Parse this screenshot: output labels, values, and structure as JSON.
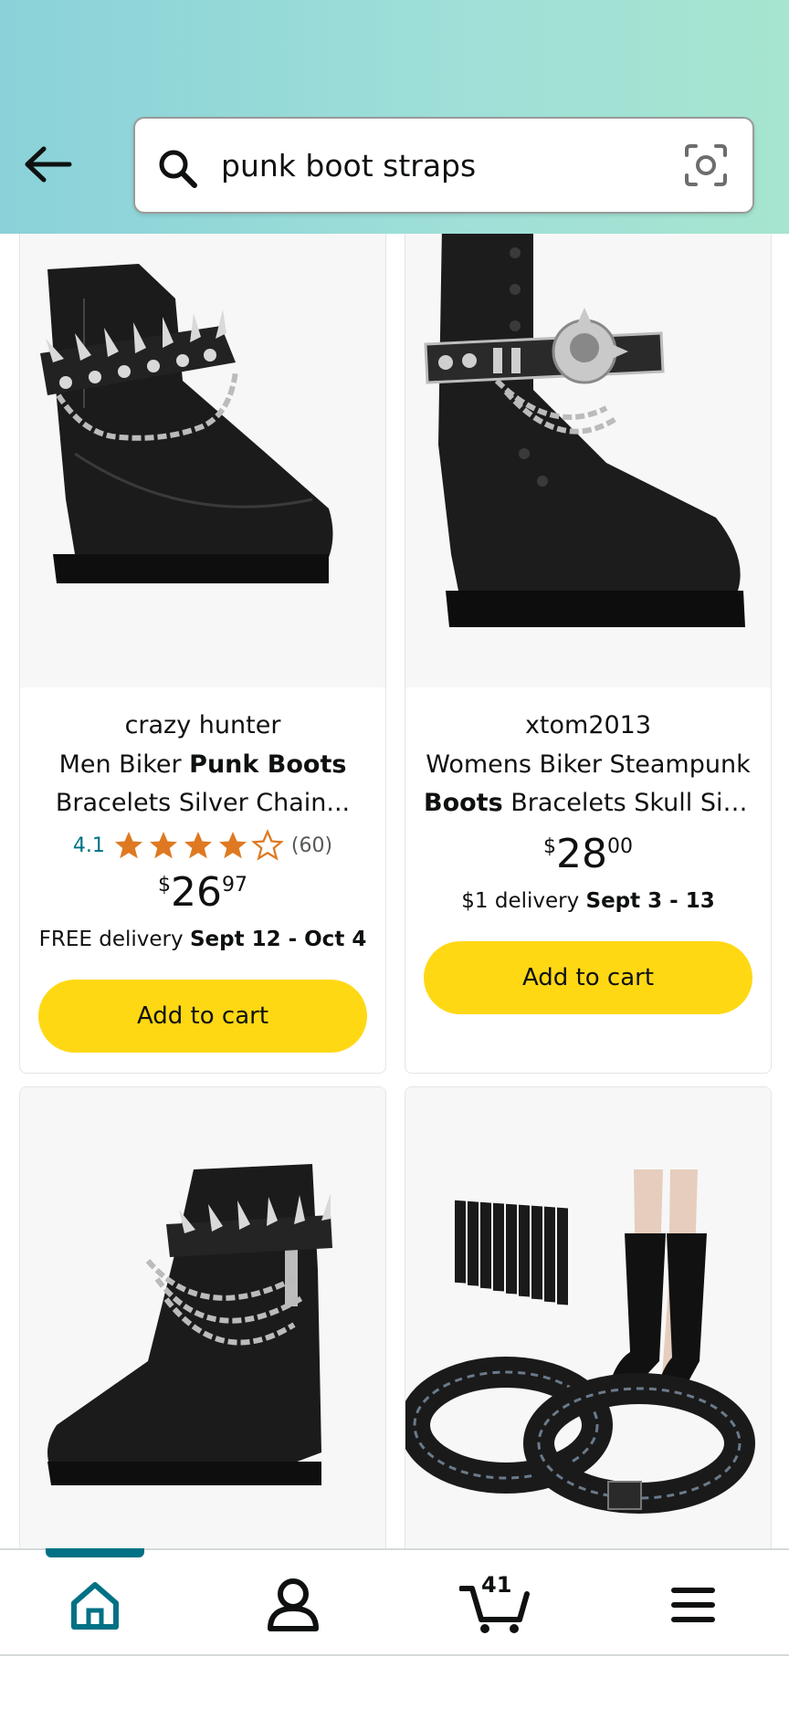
{
  "search": {
    "query": "punk boot straps"
  },
  "products": [
    {
      "brand": "crazy hunter",
      "title_line1_pre": "Men Biker ",
      "title_line1_bold": "Punk Boots",
      "title_line2": "Bracelets Silver Chain...",
      "rating": "4.1",
      "rating_value": 4.1,
      "rating_count": "(60)",
      "price_symbol": "$",
      "price_whole": "26",
      "price_fraction": "97",
      "delivery_pre": "FREE delivery ",
      "delivery_bold": "Sept 12 - Oct 4",
      "cart_label": "Add to cart"
    },
    {
      "brand": "xtom2013",
      "title_line1": "Womens Biker Steampunk",
      "title_line2_bold": "Boots",
      "title_line2_rest": " Bracelets Skull Silv...",
      "price_symbol": "$",
      "price_whole": "28",
      "price_fraction": "00",
      "delivery_pre": "$1 delivery ",
      "delivery_bold": "Sept 3 - 13",
      "cart_label": "Add to cart"
    }
  ],
  "bottom_nav": {
    "cart_count": "41",
    "icons": [
      "home-icon",
      "account-icon",
      "cart-icon",
      "menu-icon"
    ]
  },
  "colors": {
    "header_gradient_start": "#8ad1d9",
    "header_gradient_end": "#a6e5cf",
    "cart_button": "#ffd814",
    "star": "#de7921",
    "rating_link": "#007185",
    "nav_active": "#007185"
  }
}
